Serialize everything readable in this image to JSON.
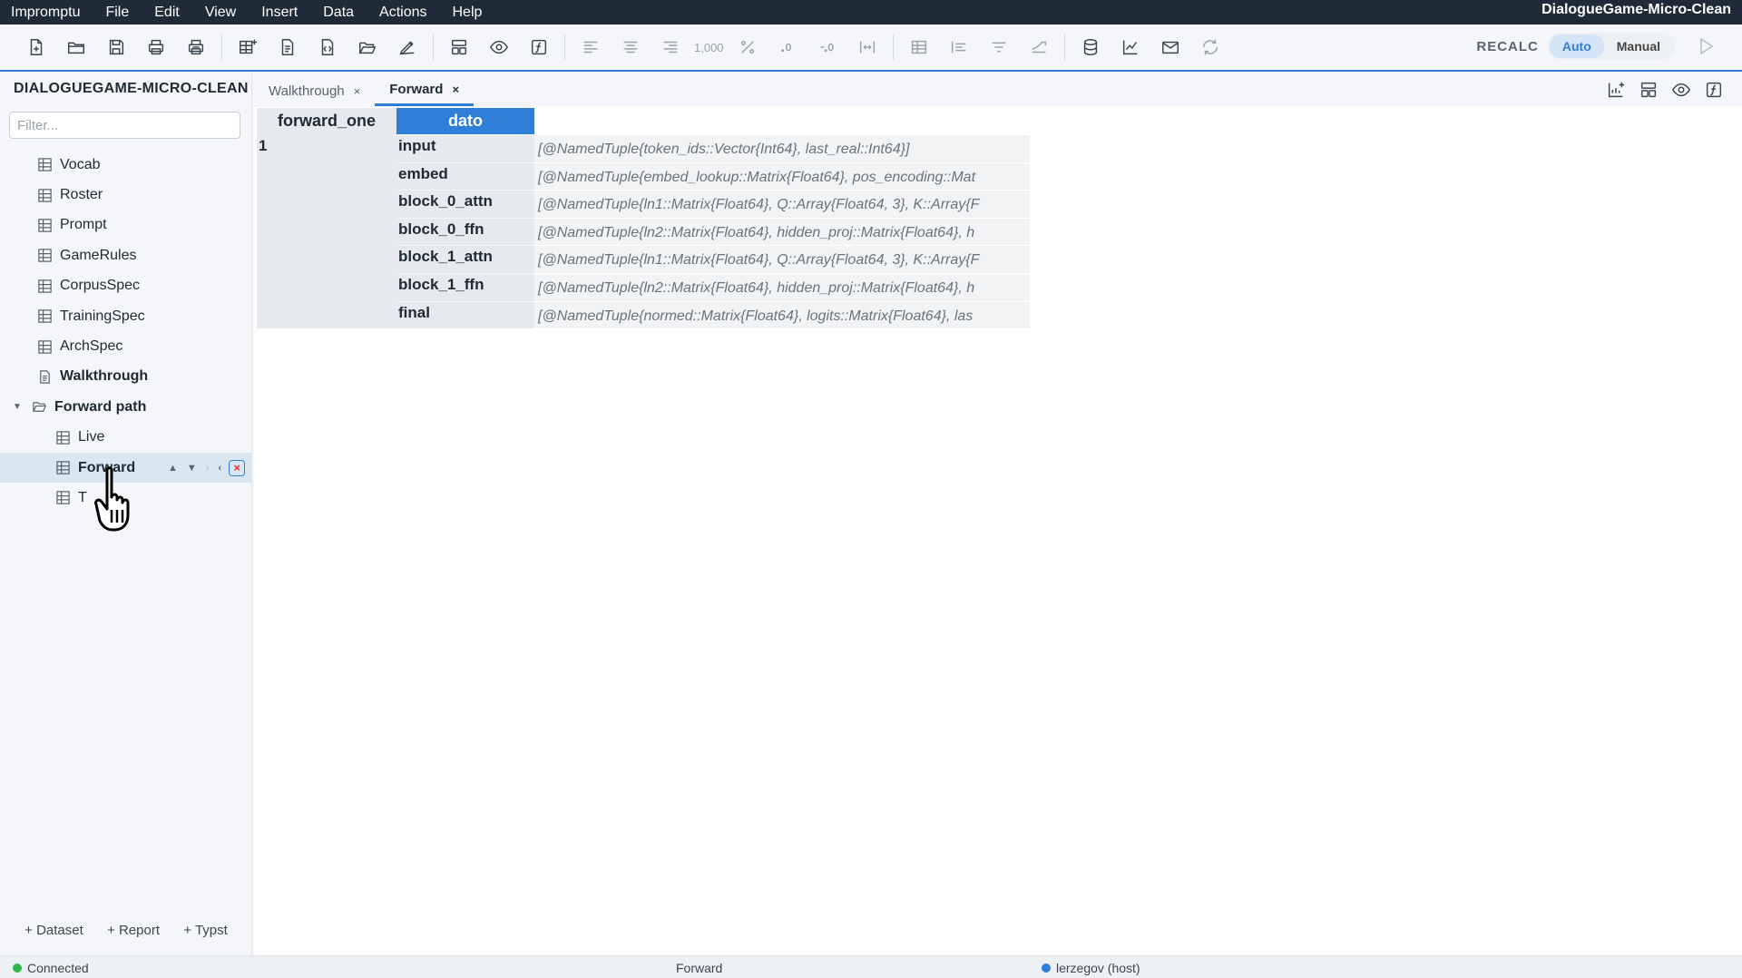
{
  "menubar": {
    "app_name": "Impromptu",
    "items": [
      "File",
      "Edit",
      "View",
      "Insert",
      "Data",
      "Actions",
      "Help"
    ],
    "document_title": "DialogueGame-Micro-Clean"
  },
  "toolbar": {
    "number_format_label": "1,000",
    "recalc_label": "RECALC",
    "mode_auto": "Auto",
    "mode_manual": "Manual",
    "active_mode": "Auto"
  },
  "sidebar": {
    "title": "DIALOGUEGAME-MICRO-CLEAN",
    "filter_placeholder": "Filter...",
    "items": [
      {
        "label": "Vocab",
        "type": "table"
      },
      {
        "label": "Roster",
        "type": "table"
      },
      {
        "label": "Prompt",
        "type": "table"
      },
      {
        "label": "GameRules",
        "type": "table"
      },
      {
        "label": "CorpusSpec",
        "type": "table"
      },
      {
        "label": "TrainingSpec",
        "type": "table"
      },
      {
        "label": "ArchSpec",
        "type": "table"
      },
      {
        "label": "Walkthrough",
        "type": "document"
      },
      {
        "label": "Forward path",
        "type": "folder"
      },
      {
        "label": "Live",
        "type": "table"
      },
      {
        "label": "Forward",
        "type": "table"
      },
      {
        "label": "T",
        "type": "table"
      }
    ],
    "footer": {
      "add_dataset": "+ Dataset",
      "add_report": "+ Report",
      "add_typst": "+ Typst"
    }
  },
  "tabs": [
    {
      "label": "Walkthrough",
      "active": false
    },
    {
      "label": "Forward",
      "active": true
    }
  ],
  "grid": {
    "header_col1": "forward_one",
    "header_col2": "dato",
    "row_number": "1",
    "rows": [
      {
        "key": "input",
        "value": "[@NamedTuple{token_ids::Vector{Int64}, last_real::Int64}]"
      },
      {
        "key": "embed",
        "value": "[@NamedTuple{embed_lookup::Matrix{Float64}, pos_encoding::Mat"
      },
      {
        "key": "block_0_attn",
        "value": "[@NamedTuple{ln1::Matrix{Float64}, Q::Array{Float64, 3}, K::Array{F"
      },
      {
        "key": "block_0_ffn",
        "value": "[@NamedTuple{ln2::Matrix{Float64}, hidden_proj::Matrix{Float64}, h"
      },
      {
        "key": "block_1_attn",
        "value": "[@NamedTuple{ln1::Matrix{Float64}, Q::Array{Float64, 3}, K::Array{F"
      },
      {
        "key": "block_1_ffn",
        "value": "[@NamedTuple{ln2::Matrix{Float64}, hidden_proj::Matrix{Float64}, h"
      },
      {
        "key": "final",
        "value": "[@NamedTuple{normed::Matrix{Float64}, logits::Matrix{Float64}, las"
      }
    ]
  },
  "statusbar": {
    "connection": "Connected",
    "current_sheet": "Forward",
    "user": "lerzegov (host)",
    "colors": {
      "connected": "#2fb84a",
      "user": "#2f7fd8"
    }
  },
  "colors": {
    "accent": "#2f7fd8",
    "menubar_bg": "#1f2b36",
    "delete_red": "#e0303a"
  }
}
